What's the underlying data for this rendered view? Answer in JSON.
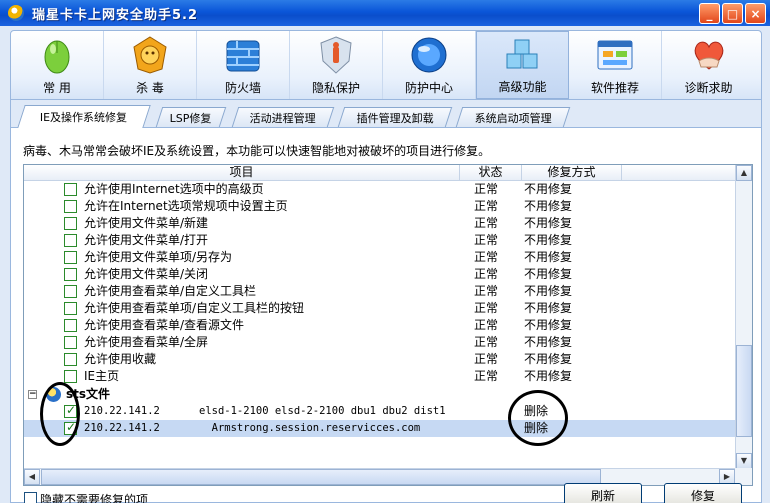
{
  "window": {
    "title": "瑞星卡卡上网安全助手5.2",
    "buttons": [
      "_",
      "□",
      "×"
    ]
  },
  "toolbar": {
    "items": [
      {
        "label": "常 用",
        "icon": "mouse-icon"
      },
      {
        "label": "杀 毒",
        "icon": "lion-shield-icon"
      },
      {
        "label": "防火墙",
        "icon": "firewall-icon"
      },
      {
        "label": "隐私保护",
        "icon": "privacy-shield-icon"
      },
      {
        "label": "防护中心",
        "icon": "protection-globe-icon"
      },
      {
        "label": "高级功能",
        "icon": "cubes-icon"
      },
      {
        "label": "软件推荐",
        "icon": "software-window-icon"
      },
      {
        "label": "诊断求助",
        "icon": "heart-hand-icon"
      }
    ],
    "active_index": 5
  },
  "tabs": [
    {
      "label": "IE及操作系统修复"
    },
    {
      "label": "LSP修复"
    },
    {
      "label": "活动进程管理"
    },
    {
      "label": "插件管理及卸载"
    },
    {
      "label": "系统启动项管理"
    }
  ],
  "description": "病毒、木马常常会破坏IE及系统设置，本功能可以快速智能地对被破坏的项目进行修复。",
  "grid": {
    "columns": [
      "项目",
      "状态",
      "修复方式"
    ],
    "rows": [
      {
        "item": "允许使用Internet选项中的高级页",
        "status": "正常",
        "fix": "不用修复"
      },
      {
        "item": "允许在Internet选项常规项中设置主页",
        "status": "正常",
        "fix": "不用修复"
      },
      {
        "item": "允许使用文件菜单/新建",
        "status": "正常",
        "fix": "不用修复"
      },
      {
        "item": "允许使用文件菜单/打开",
        "status": "正常",
        "fix": "不用修复"
      },
      {
        "item": "允许使用文件菜单项/另存为",
        "status": "正常",
        "fix": "不用修复"
      },
      {
        "item": "允许使用文件菜单/关闭",
        "status": "正常",
        "fix": "不用修复"
      },
      {
        "item": "允许使用查看菜单/自定义工具栏",
        "status": "正常",
        "fix": "不用修复"
      },
      {
        "item": "允许使用查看菜单项/自定义工具栏的按钮",
        "status": "正常",
        "fix": "不用修复"
      },
      {
        "item": "允许使用查看菜单/查看源文件",
        "status": "正常",
        "fix": "不用修复"
      },
      {
        "item": "允许使用查看菜单/全屏",
        "status": "正常",
        "fix": "不用修复"
      },
      {
        "item": "允许使用收藏",
        "status": "正常",
        "fix": "不用修复"
      },
      {
        "item": "IE主页",
        "status": "正常",
        "fix": "不用修复"
      }
    ],
    "group": {
      "label": "sts文件",
      "expander": "−"
    },
    "hosts": [
      {
        "ip": "210.22.141.2",
        "entry": "elsd-1-2100 elsd-2-2100 dbu1 dbu2 dist1",
        "fix": "删除",
        "checked": true
      },
      {
        "ip": "210.22.141.2",
        "entry": "  Armstrong.session.reservicces.com",
        "fix": "删除",
        "checked": true
      }
    ],
    "scroll_up": "▲",
    "scroll_down": "▼",
    "scroll_left": "◀",
    "scroll_right": "▶"
  },
  "footer": {
    "hide_label": "隐藏不需要修复的项",
    "refresh_label": "刷新",
    "repair_label": "修复"
  }
}
